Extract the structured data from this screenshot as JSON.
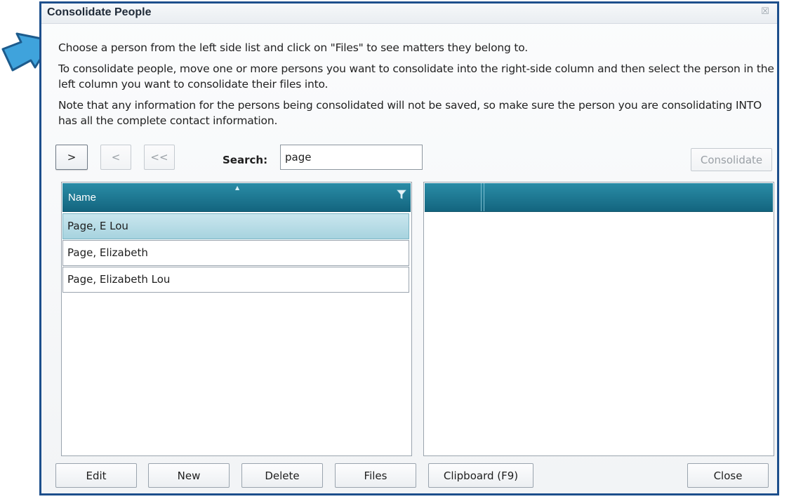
{
  "dialog": {
    "title": "Consolidate People",
    "close_glyph": "☒"
  },
  "instructions": {
    "line1": "Choose a person from the left side list and click on \"Files\" to see matters they belong to.",
    "line2": "To consolidate people, move one or more persons you want to consolidate into the right-side column and then select the person in the left column you want to consolidate their files into.",
    "line3": "Note that any information for the persons being consolidated will not be saved, so make sure the person you are consolidating INTO has all the complete contact information."
  },
  "toolbar": {
    "move_right_label": ">",
    "move_left_label": "<",
    "move_all_left_label": "<<",
    "search_label": "Search:",
    "search_value": "page",
    "consolidate_label": "Consolidate"
  },
  "left_grid": {
    "column_header": "Name",
    "rows": [
      "Page, E Lou",
      "Page, Elizabeth",
      "Page, Elizabeth Lou"
    ],
    "selected_index": 0
  },
  "bottom_buttons": {
    "edit": "Edit",
    "new": "New",
    "delete": "Delete",
    "files": "Files",
    "clipboard": "Clipboard (F9)",
    "close": "Close"
  },
  "icons": {
    "pointer": "arrow-pointer-icon",
    "filter": "filter-icon",
    "close": "close-icon"
  },
  "colors": {
    "header_teal": "#13657f",
    "dialog_border": "#1d4f8c",
    "selected_row": "#a7d3df",
    "pointer_blue": "#3fa3dc"
  }
}
